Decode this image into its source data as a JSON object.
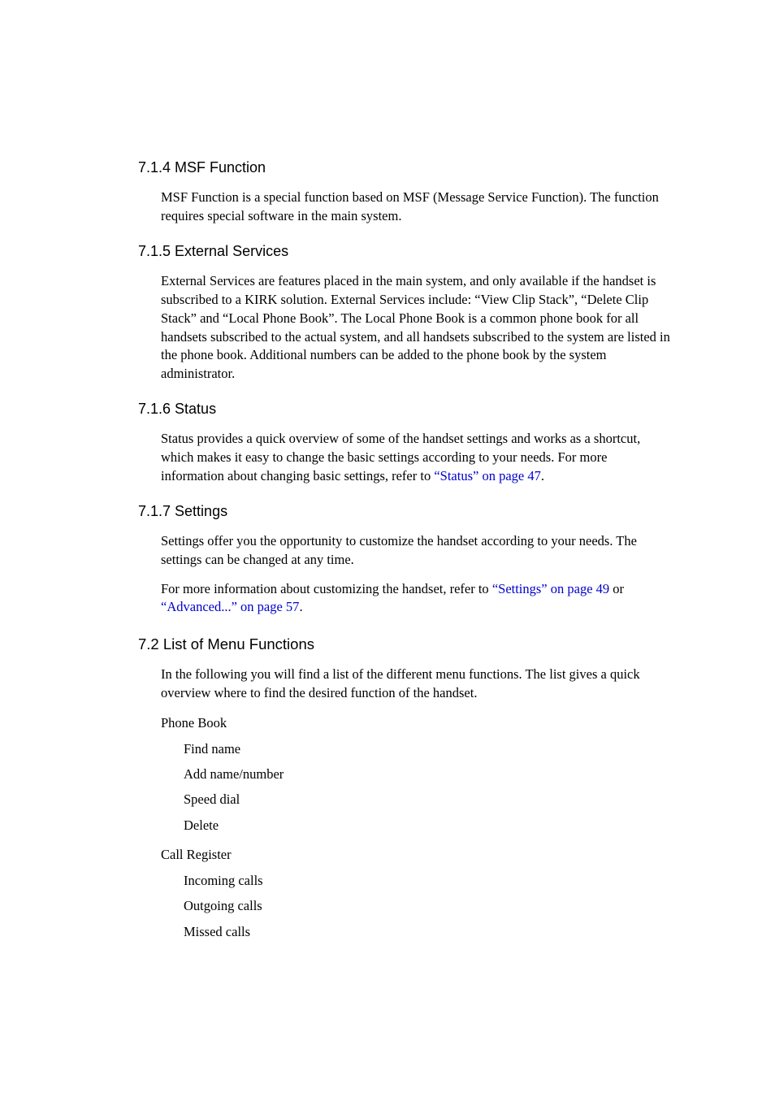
{
  "sections": {
    "s714": {
      "heading": "7.1.4  MSF Function",
      "p1": "MSF Function is a special function based on MSF (Message Service Function). The function requires special software in the main system."
    },
    "s715": {
      "heading": "7.1.5  External Services",
      "p1": "External Services are features placed in the main system, and only available if the handset is subscribed to a KIRK solution. External Services include: “View Clip Stack”, “Delete Clip Stack” and “Local Phone Book”. The Local Phone Book is a common phone book for all handsets subscribed to the actual system, and all handsets subscribed to the system are listed in the phone book. Additional numbers can be added to the phone book by the system administrator."
    },
    "s716": {
      "heading": "7.1.6  Status",
      "p1_pre": "Status provides a quick overview of some of the handset settings and works as a shortcut, which makes it easy to change the basic settings according to your needs. For more information about changing basic settings, refer to ",
      "p1_link": "“Status” on page 47",
      "p1_post": "."
    },
    "s717": {
      "heading": "7.1.7  Settings",
      "p1": "Settings offer you the opportunity to customize the handset according to your needs. The settings can be changed at any time.",
      "p2_pre": "For more information about customizing the handset, refer to ",
      "p2_link1": "“Settings” on page 49",
      "p2_mid": " or ",
      "p2_link2": "“Advanced...” on page 57",
      "p2_post": "."
    },
    "s72": {
      "heading": "7.2  List of Menu Functions",
      "intro": "In the following you will find a list of the different menu functions. The list gives a quick overview where to find the desired function of the handset.",
      "group1_label": "Phone Book",
      "group1_items": [
        "Find name",
        "Add name/number",
        "Speed dial",
        "Delete"
      ],
      "group2_label": "Call Register",
      "group2_items": [
        "Incoming calls",
        "Outgoing calls",
        "Missed calls"
      ]
    }
  }
}
